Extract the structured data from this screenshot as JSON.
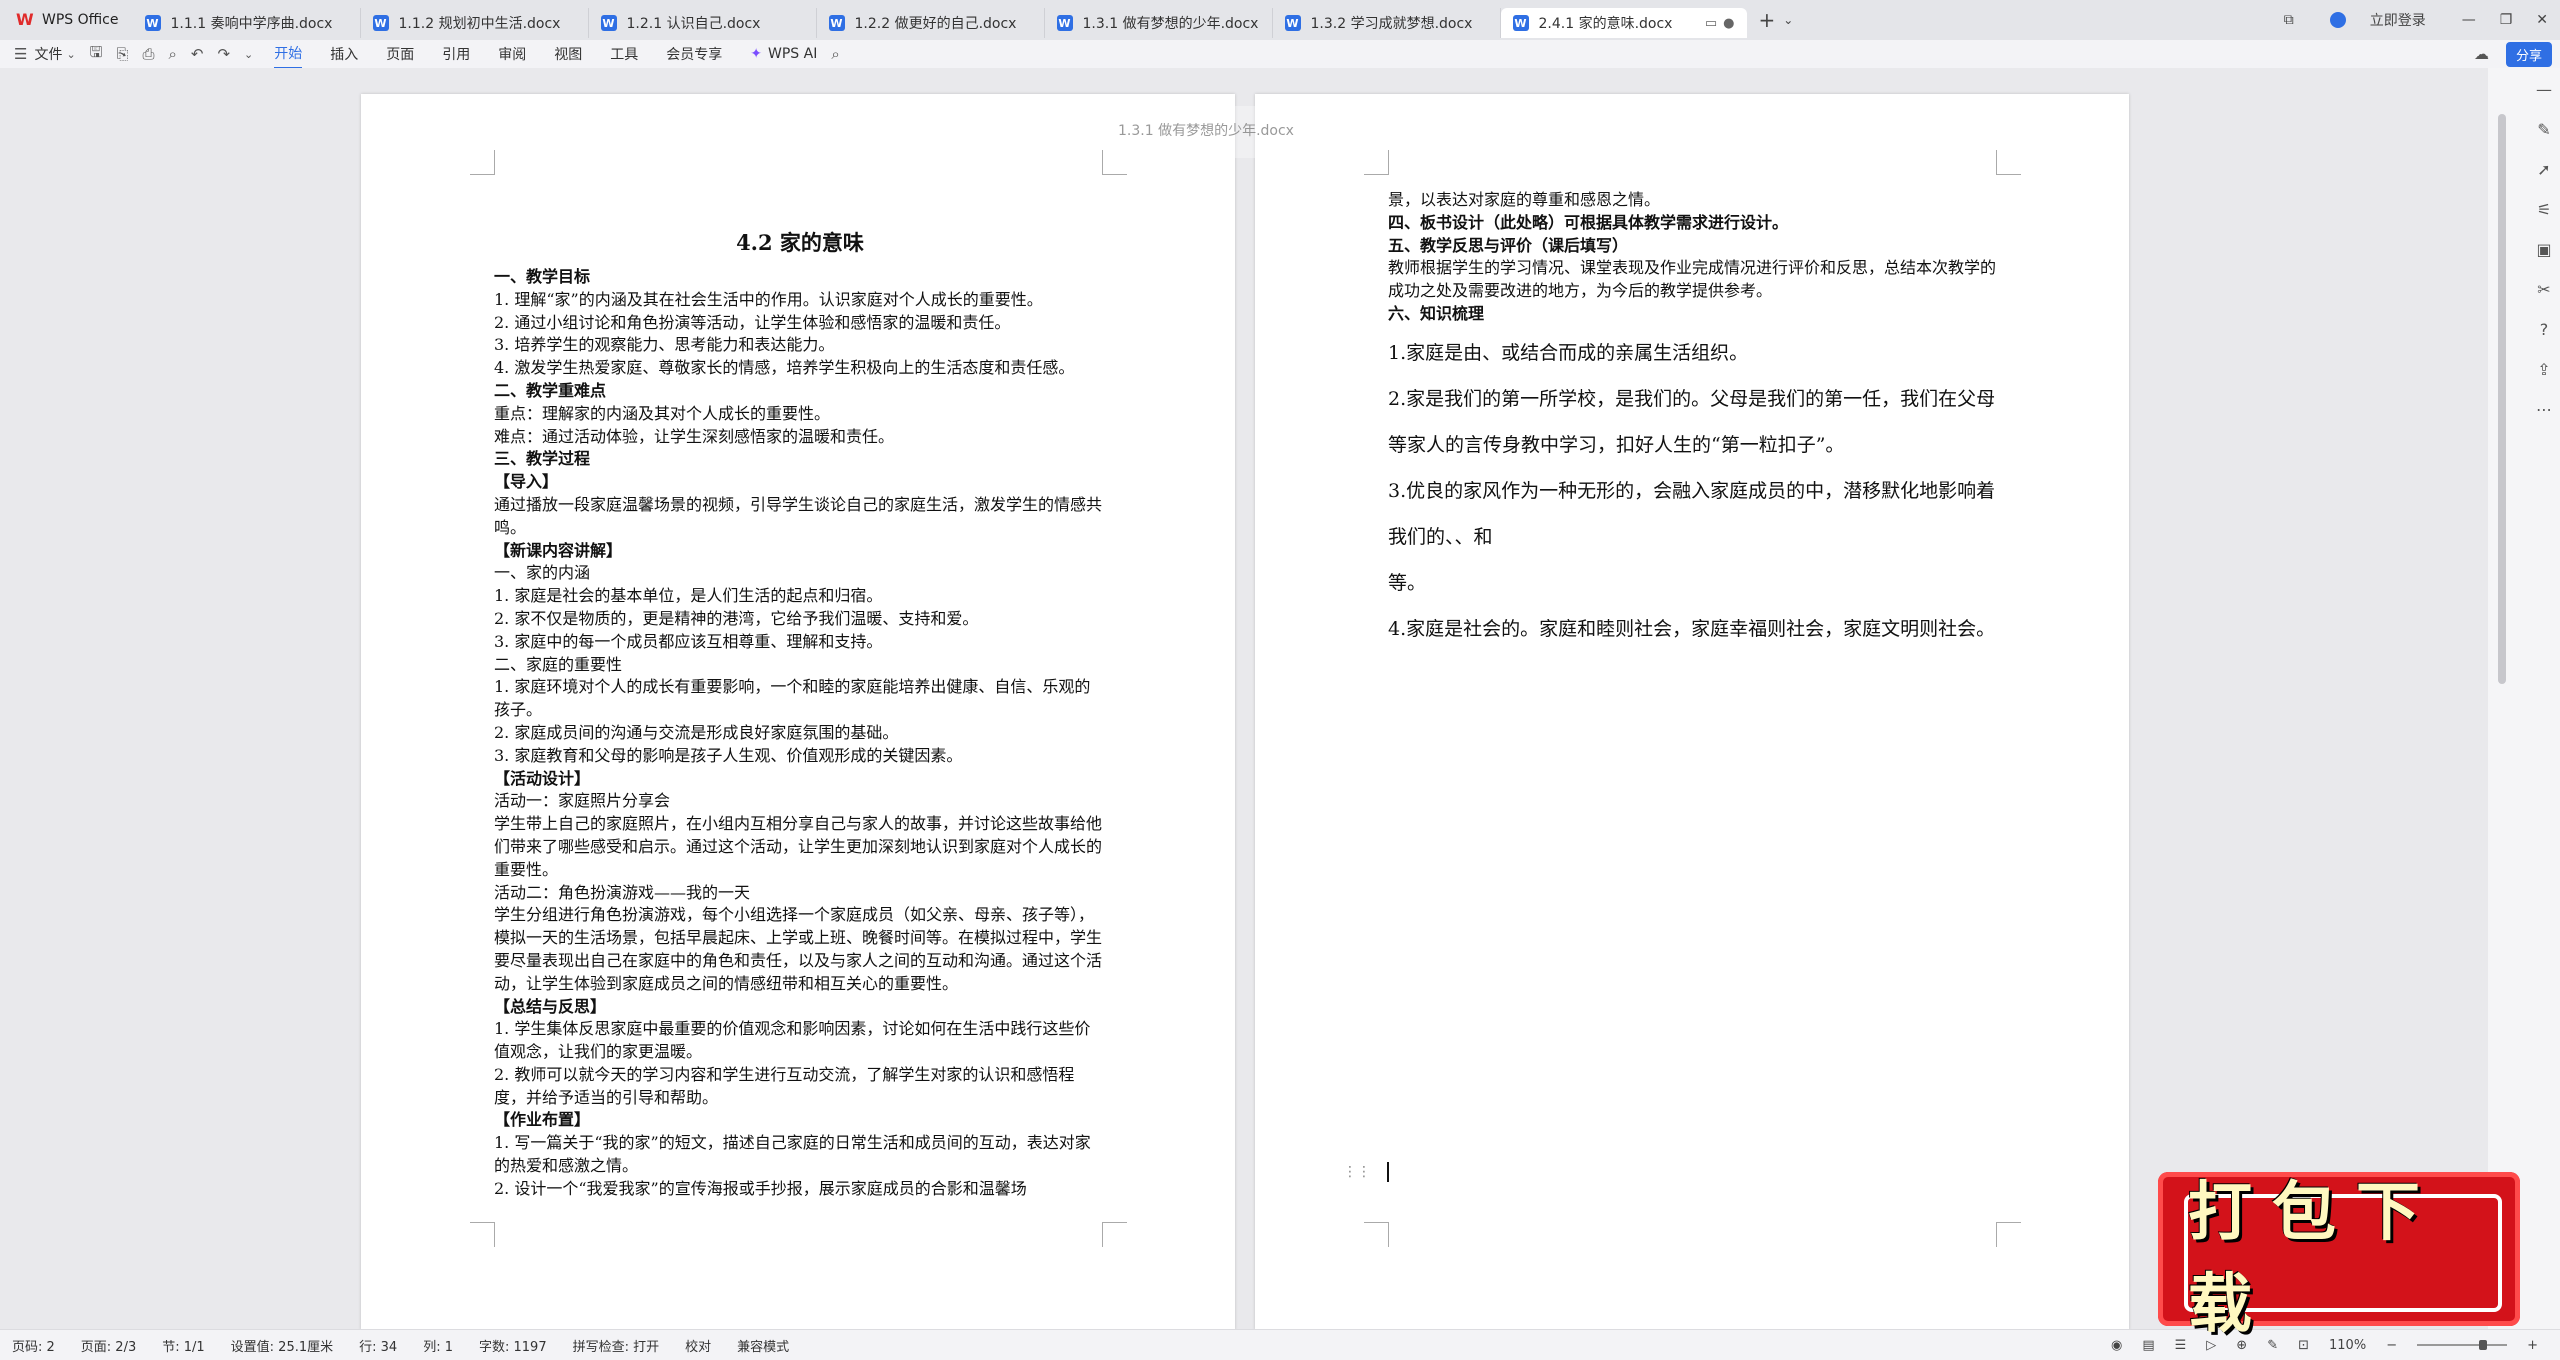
{
  "tabs": {
    "app": "WPS Office",
    "docs": [
      {
        "label": "1.1.1 奏响中学序曲.docx"
      },
      {
        "label": "1.1.2 规划初中生活.docx"
      },
      {
        "label": "1.2.1 认识自己.docx"
      },
      {
        "label": "1.2.2 做更好的自己.docx"
      },
      {
        "label": "1.3.1 做有梦想的少年.docx"
      },
      {
        "label": "1.3.2 学习成就梦想.docx"
      },
      {
        "label": "2.4.1 家的意味.docx"
      }
    ],
    "login": "立即登录"
  },
  "ribbon": {
    "file": "文件",
    "tabs": [
      "开始",
      "插入",
      "页面",
      "引用",
      "审阅",
      "视图",
      "工具",
      "会员专享"
    ],
    "ai": "WPS AI",
    "share": "分享"
  },
  "ghost": {
    "title": "1.3.1 做有梦想的少年.docx"
  },
  "doc": {
    "title": "4.2 家的意味",
    "left_lines": [
      {
        "t": "一、教学目标",
        "h": true
      },
      {
        "t": "1. 理解“家”的内涵及其在社会生活中的作用。认识家庭对个人成长的重要性。"
      },
      {
        "t": "2. 通过小组讨论和角色扮演等活动，让学生体验和感悟家的温暖和责任。"
      },
      {
        "t": "3. 培养学生的观察能力、思考能力和表达能力。"
      },
      {
        "t": "4. 激发学生热爱家庭、尊敬家长的情感，培养学生积极向上的生活态度和责任感。"
      },
      {
        "t": "二、教学重难点",
        "h": true
      },
      {
        "t": "重点：理解家的内涵及其对个人成长的重要性。"
      },
      {
        "t": "难点：通过活动体验，让学生深刻感悟家的温暖和责任。"
      },
      {
        "t": "三、教学过程",
        "h": true
      },
      {
        "t": "【导入】",
        "h": true
      },
      {
        "t": "通过播放一段家庭温馨场景的视频，引导学生谈论自己的家庭生活，激发学生的情感共鸣。"
      },
      {
        "t": "【新课内容讲解】",
        "h": true
      },
      {
        "t": "一、家的内涵"
      },
      {
        "t": "1. 家庭是社会的基本单位，是人们生活的起点和归宿。"
      },
      {
        "t": "2. 家不仅是物质的，更是精神的港湾，它给予我们温暖、支持和爱。"
      },
      {
        "t": "3. 家庭中的每一个成员都应该互相尊重、理解和支持。"
      },
      {
        "t": "二、家庭的重要性"
      },
      {
        "t": "1. 家庭环境对个人的成长有重要影响，一个和睦的家庭能培养出健康、自信、乐观的孩子。"
      },
      {
        "t": "2. 家庭成员间的沟通与交流是形成良好家庭氛围的基础。"
      },
      {
        "t": "3. 家庭教育和父母的影响是孩子人生观、价值观形成的关键因素。"
      },
      {
        "t": "【活动设计】",
        "h": true
      },
      {
        "t": "活动一：家庭照片分享会"
      },
      {
        "t": "学生带上自己的家庭照片，在小组内互相分享自己与家人的故事，并讨论这些故事给他们带来了哪些感受和启示。通过这个活动，让学生更加深刻地认识到家庭对个人成长的重要性。"
      },
      {
        "t": "活动二：角色扮演游戏——我的一天"
      },
      {
        "t": "学生分组进行角色扮演游戏，每个小组选择一个家庭成员（如父亲、母亲、孩子等），模拟一天的生活场景，包括早晨起床、上学或上班、晚餐时间等。在模拟过程中，学生要尽量表现出自己在家庭中的角色和责任，以及与家人之间的互动和沟通。通过这个活动，让学生体验到家庭成员之间的情感纽带和相互关心的重要性。"
      },
      {
        "t": "【总结与反思】",
        "h": true
      },
      {
        "t": "1.  学生集体反思家庭中最重要的价值观念和影响因素，讨论如何在生活中践行这些价值观念，让我们的家更温暖。"
      },
      {
        "t": "2.  教师可以就今天的学习内容和学生进行互动交流，了解学生对家的认识和感悟程度，并给予适当的引导和帮助。"
      },
      {
        "t": "【作业布置】",
        "h": true
      },
      {
        "t": "1.  写一篇关于“我的家”的短文，描述自己家庭的日常生活和成员间的互动，表达对家的热爱和感激之情。"
      },
      {
        "t": "2.  设计一个“我爱我家”的宣传海报或手抄报，展示家庭成员的合影和温馨场"
      }
    ],
    "right_lines": [
      {
        "t": "景，以表达对家庭的尊重和感恩之情。"
      },
      {
        "t": "四、板书设计（此处略）可根据具体教学需求进行设计。",
        "h": true
      },
      {
        "t": "五、教学反思与评价（课后填写）",
        "h": true
      },
      {
        "t": "教师根据学生的学习情况、课堂表现及作业完成情况进行评价和反思，总结本次教学的成功之处及需要改进的地方，为今后的教学提供参考。"
      },
      {
        "t": "六、知识梳理",
        "h": true
      }
    ],
    "knowledge": [
      "1.家庭是由、或结合而成的亲属生活组织。",
      "2.家是我们的第一所学校，是我们的。父母是我们的第一任，我们在父母等家人的言传身教中学习，扣好人生的“第一粒扣子”。",
      "3.优良的家风作为一种无形的，会融入家庭成员的中，潜移默化地影响着我们的、、和",
      "等。",
      "4.家庭是社会的。家庭和睦则社会，家庭幸福则社会，家庭文明则社会。"
    ]
  },
  "status": {
    "page_code": "页码: 2",
    "page": "页面: 2/3",
    "section": "节: 1/1",
    "setting": "设置值: 25.1厘米",
    "row": "行: 34",
    "col": "列: 1",
    "words": "字数: 1197",
    "spell": "拼写检查: 打开",
    "proof": "校对",
    "compat": "兼容模式",
    "zoom": "110%",
    "zoom_value": 110
  },
  "promo": {
    "text": "打包下载"
  },
  "colors": {
    "accent": "#2f6fe4",
    "promo": "#d3121a"
  }
}
